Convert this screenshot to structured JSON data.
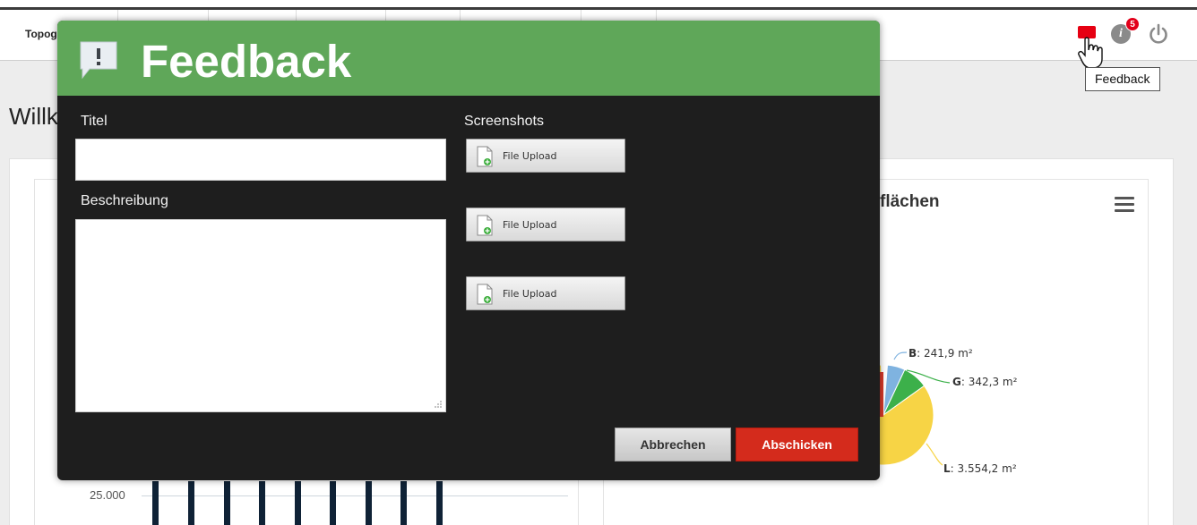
{
  "navbar": {
    "tabs": [
      {
        "label": "Topographie"
      },
      {
        "label": ""
      },
      {
        "label": ""
      },
      {
        "label": ""
      },
      {
        "label": ""
      },
      {
        "label": ""
      },
      {
        "label": ""
      }
    ],
    "feedback_tooltip": "Feedback",
    "info_badge_count": "5",
    "feedback_icon": "feedback-flag-icon",
    "info_icon": "info-icon",
    "power_icon": "power-icon"
  },
  "page": {
    "welcome_title": "Willkommen"
  },
  "pie_chart": {
    "title": "flächen",
    "labels": [
      {
        "key": "B",
        "value": "241,9 m²"
      },
      {
        "key": "G",
        "value": "342,3 m²"
      },
      {
        "key": "L",
        "value": "3.554,2 m²"
      }
    ]
  },
  "bar_chart": {
    "ytick_label": "25.000"
  },
  "chart_data": [
    {
      "type": "pie",
      "title": "flächen",
      "categories": [
        "B",
        "G",
        "L"
      ],
      "values": [
        241.9,
        342.3,
        3554.2
      ],
      "unit": "m²",
      "colors": [
        "#7fb3e0",
        "#3cb04a",
        "#f7d445"
      ]
    }
  ],
  "modal": {
    "title": "Feedback",
    "title_icon": "speech-bubble-exclamation-icon",
    "titel_label": "Titel",
    "titel_value": "",
    "beschreibung_label": "Beschreibung",
    "beschreibung_value": "",
    "screenshots_label": "Screenshots",
    "uploads": [
      {
        "label": "File Upload"
      },
      {
        "label": "File Upload"
      },
      {
        "label": "File Upload"
      }
    ],
    "cancel_label": "Abbrechen",
    "submit_label": "Abschicken",
    "colors": {
      "header": "#5fa759",
      "body": "#1e1e1e",
      "submit": "#d42b1c"
    }
  }
}
